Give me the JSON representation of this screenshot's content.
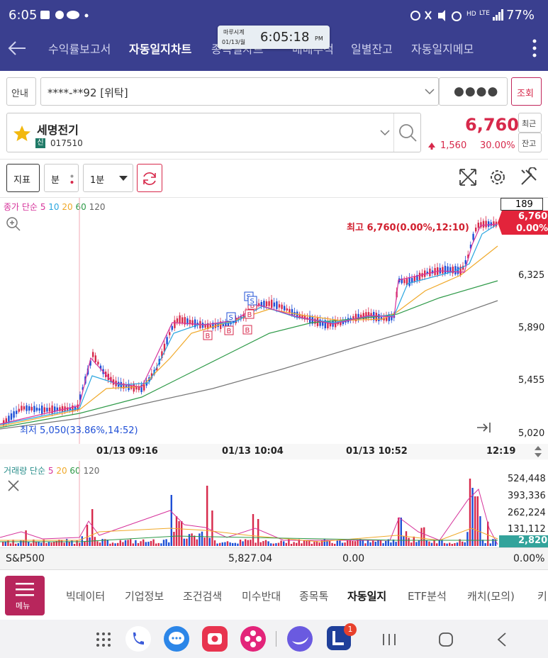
{
  "status": {
    "time": "6:05",
    "battery": "77%",
    "network": "LTE",
    "hd": "HD"
  },
  "nav": {
    "back_icon": "arrow-left-icon",
    "tabs": [
      "수익률보고서",
      "자동일지차트",
      "종목별차트",
      "매매추적",
      "일별잔고",
      "자동일지메모"
    ],
    "active_tab": 1,
    "more_icon": "kebab-icon"
  },
  "clock_widget": {
    "title": "마루시계",
    "date": "01/13/월",
    "time": "6:05:18",
    "ampm": "PM"
  },
  "account": {
    "guide_label": "안내",
    "account_value": "****-**92 [위탁]",
    "password_mask": "●●●●",
    "query_label": "조회"
  },
  "stock": {
    "name": "세명전기",
    "badge": "신",
    "code": "017510",
    "price": "6,760",
    "change": "1,560",
    "change_rate": "30.00%",
    "recent_label": "최근",
    "balance_label": "잔고"
  },
  "toolbar": {
    "indicator_label": "지표",
    "period_label": "분",
    "interval_value": "1분"
  },
  "price_chart": {
    "legend": {
      "prefix": "종가 단순",
      "ma": [
        "5",
        "10",
        "20",
        "60",
        "120"
      ]
    },
    "current_count": "189",
    "last_price": "6,760",
    "last_rate": "0.00%",
    "high_label": "최고 6,760(0.00%,12:10)",
    "low_label": "최저 5,050(33.86%,14:52)",
    "y_ticks": [
      "6,325",
      "5,890",
      "5,455",
      "5,020"
    ],
    "x_ticks": [
      "01/13 09:16",
      "01/13 10:04",
      "01/13 10:52",
      "12:19"
    ]
  },
  "volume_chart": {
    "legend": {
      "prefix": "거래량 단순",
      "ma": [
        "5",
        "20",
        "60",
        "120"
      ]
    },
    "y_ticks": [
      "524,448",
      "393,336",
      "262,224",
      "131,112"
    ],
    "last_volume": "2,820"
  },
  "index_bar": {
    "name": "S&P500",
    "value": "5,827.04",
    "change": "0.00",
    "rate": "0.00%"
  },
  "bottom_menu": {
    "menu_label": "메뉴",
    "items": [
      "빅데이터",
      "기업정보",
      "조건검색",
      "미수반대",
      "종목톡",
      "자동일지",
      "ETF분석",
      "캐치(모의)",
      "키"
    ],
    "active": 5
  },
  "system_nav": {
    "badge_count": "1"
  },
  "colors": {
    "header": "#3a3f8f",
    "up": "#d7294b",
    "down": "#1f4fd6",
    "ma5": "#d6339b",
    "ma10": "#2aa6e0",
    "ma20": "#f0a92a",
    "ma60": "#2e9a48",
    "ma120": "#666666"
  }
}
